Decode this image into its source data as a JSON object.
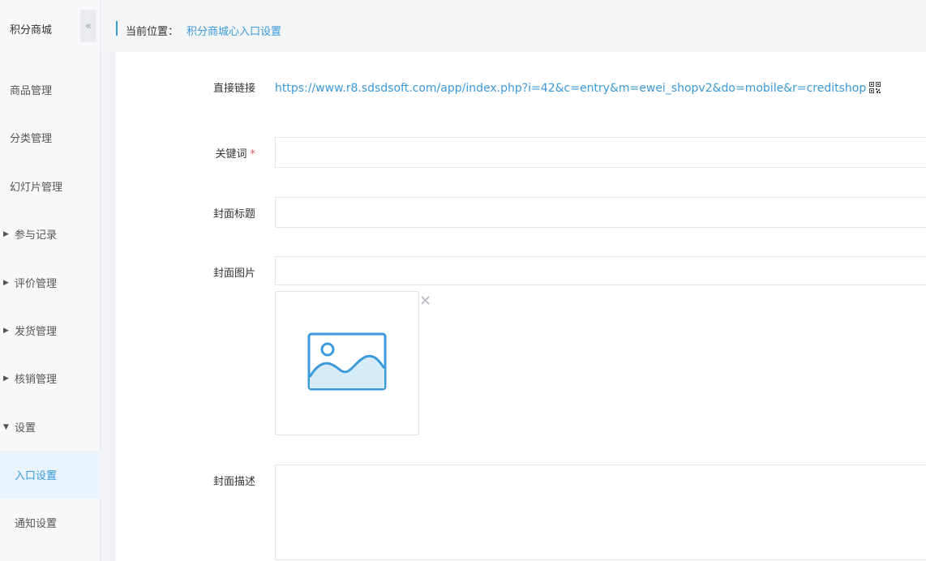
{
  "sidebar": {
    "title": "积分商城",
    "collapse_icon": "«",
    "items": [
      {
        "label": "商品管理",
        "kind": "plain"
      },
      {
        "label": "分类管理",
        "kind": "plain"
      },
      {
        "label": "幻灯片管理",
        "kind": "plain"
      },
      {
        "label": "参与记录",
        "kind": "group",
        "caret": "▶"
      },
      {
        "label": "评价管理",
        "kind": "group",
        "caret": "▶"
      },
      {
        "label": "发货管理",
        "kind": "group",
        "caret": "▶"
      },
      {
        "label": "核销管理",
        "kind": "group",
        "caret": "▶"
      },
      {
        "label": "设置",
        "kind": "group",
        "caret": "▼"
      },
      {
        "label": "入口设置",
        "kind": "sub",
        "active": true
      },
      {
        "label": "通知设置",
        "kind": "sub"
      }
    ]
  },
  "breadcrumb": {
    "prefix": "当前位置：",
    "current": "积分商城心入口设置"
  },
  "form": {
    "direct_link": {
      "label": "直接链接",
      "url": "https://www.r8.sdsdsoft.com/app/index.php?i=42&c=entry&m=ewei_shopv2&do=mobile&r=creditshop"
    },
    "keyword": {
      "label": "关键词",
      "required_mark": "*",
      "value": ""
    },
    "cover_title": {
      "label": "封面标题",
      "value": ""
    },
    "cover_image": {
      "label": "封面图片",
      "value": "",
      "remove_icon": "✕"
    },
    "cover_desc": {
      "label": "封面描述",
      "value": ""
    }
  },
  "colors": {
    "accent": "#3b9ad9",
    "required": "#e25b5b",
    "sidebar_bg": "#f7f8fa",
    "active_bg": "#e8f3fc"
  }
}
